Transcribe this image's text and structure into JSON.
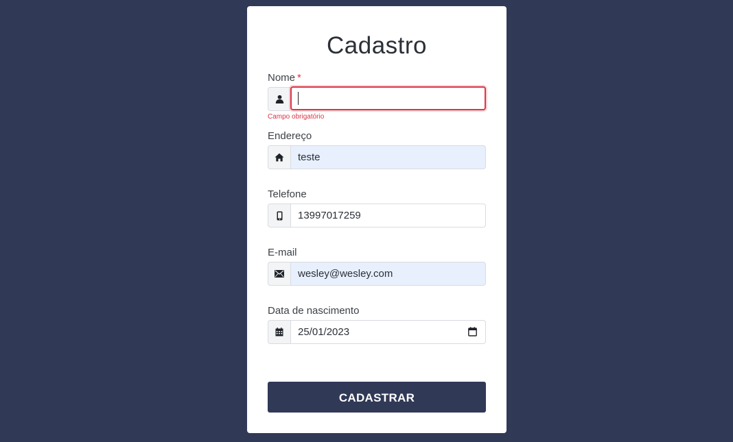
{
  "form": {
    "title": "Cadastro",
    "required_marker": "*",
    "fields": [
      {
        "label": "Nome",
        "icon": "user-icon",
        "value": "",
        "error": "Campo obrigatório"
      },
      {
        "label": "Endereço",
        "icon": "home-icon",
        "value": "teste"
      },
      {
        "label": "Telefone",
        "icon": "mobile-phone-icon",
        "value": "13997017259"
      },
      {
        "label": "E-mail",
        "icon": "envelope-icon",
        "value": "wesley@wesley.com"
      },
      {
        "label": "Data de nascimento",
        "icon": "calendar-icon",
        "value": "25/01/2023"
      }
    ],
    "submit_label": "CADASTRAR"
  },
  "colors": {
    "background": "#303956",
    "card": "#ffffff",
    "error": "#dc3545",
    "autofill": "#e8f0fe",
    "button": "#303956"
  }
}
